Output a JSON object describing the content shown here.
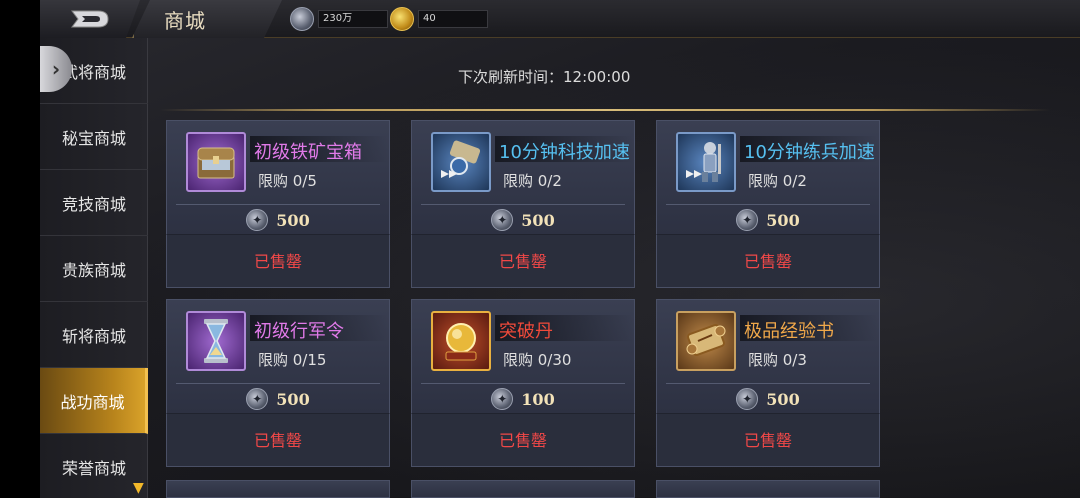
{
  "header": {
    "title": "商城",
    "resources": [
      {
        "icon": "silver-coin-icon",
        "value": "230万"
      },
      {
        "icon": "gold-ingot-icon",
        "value": "40"
      }
    ]
  },
  "sidebar": {
    "items": [
      {
        "label": "武将商城",
        "active": false
      },
      {
        "label": "秘宝商城",
        "active": false
      },
      {
        "label": "竞技商城",
        "active": false
      },
      {
        "label": "贵族商城",
        "active": false
      },
      {
        "label": "斩将商城",
        "active": false
      },
      {
        "label": "战功商城",
        "active": true
      },
      {
        "label": "荣誉商城",
        "active": false
      }
    ]
  },
  "refresh_text": "下次刷新时间：12:00:00",
  "products": [
    {
      "name": "初级铁矿宝箱",
      "limit": "限购 0/5",
      "price": "500",
      "status": "已售罄",
      "rarity": "purple",
      "icon": "treasure-chest-icon"
    },
    {
      "name": "10分钟科技加速",
      "limit": "限购 0/2",
      "price": "500",
      "status": "已售罄",
      "rarity": "blue",
      "icon": "tech-speedup-icon"
    },
    {
      "name": "10分钟练兵加速",
      "limit": "限购 0/2",
      "price": "500",
      "status": "已售罄",
      "rarity": "blue",
      "icon": "training-speedup-icon"
    },
    {
      "name": "初级行军令",
      "limit": "限购 0/15",
      "price": "500",
      "status": "已售罄",
      "rarity": "purple",
      "icon": "hourglass-icon"
    },
    {
      "name": "突破丹",
      "limit": "限购 0/30",
      "price": "100",
      "status": "已售罄",
      "rarity": "red",
      "icon": "golden-pill-icon"
    },
    {
      "name": "极品经验书",
      "limit": "限购 0/3",
      "price": "500",
      "status": "已售罄",
      "rarity": "orange",
      "icon": "exp-scroll-icon"
    }
  ],
  "colors": {
    "purple": "#e07ae8",
    "blue": "#56c0f0",
    "red": "#f04a3a",
    "orange": "#f0a84a",
    "sold_out": "#f04848",
    "active_tab": "#b8841c"
  }
}
